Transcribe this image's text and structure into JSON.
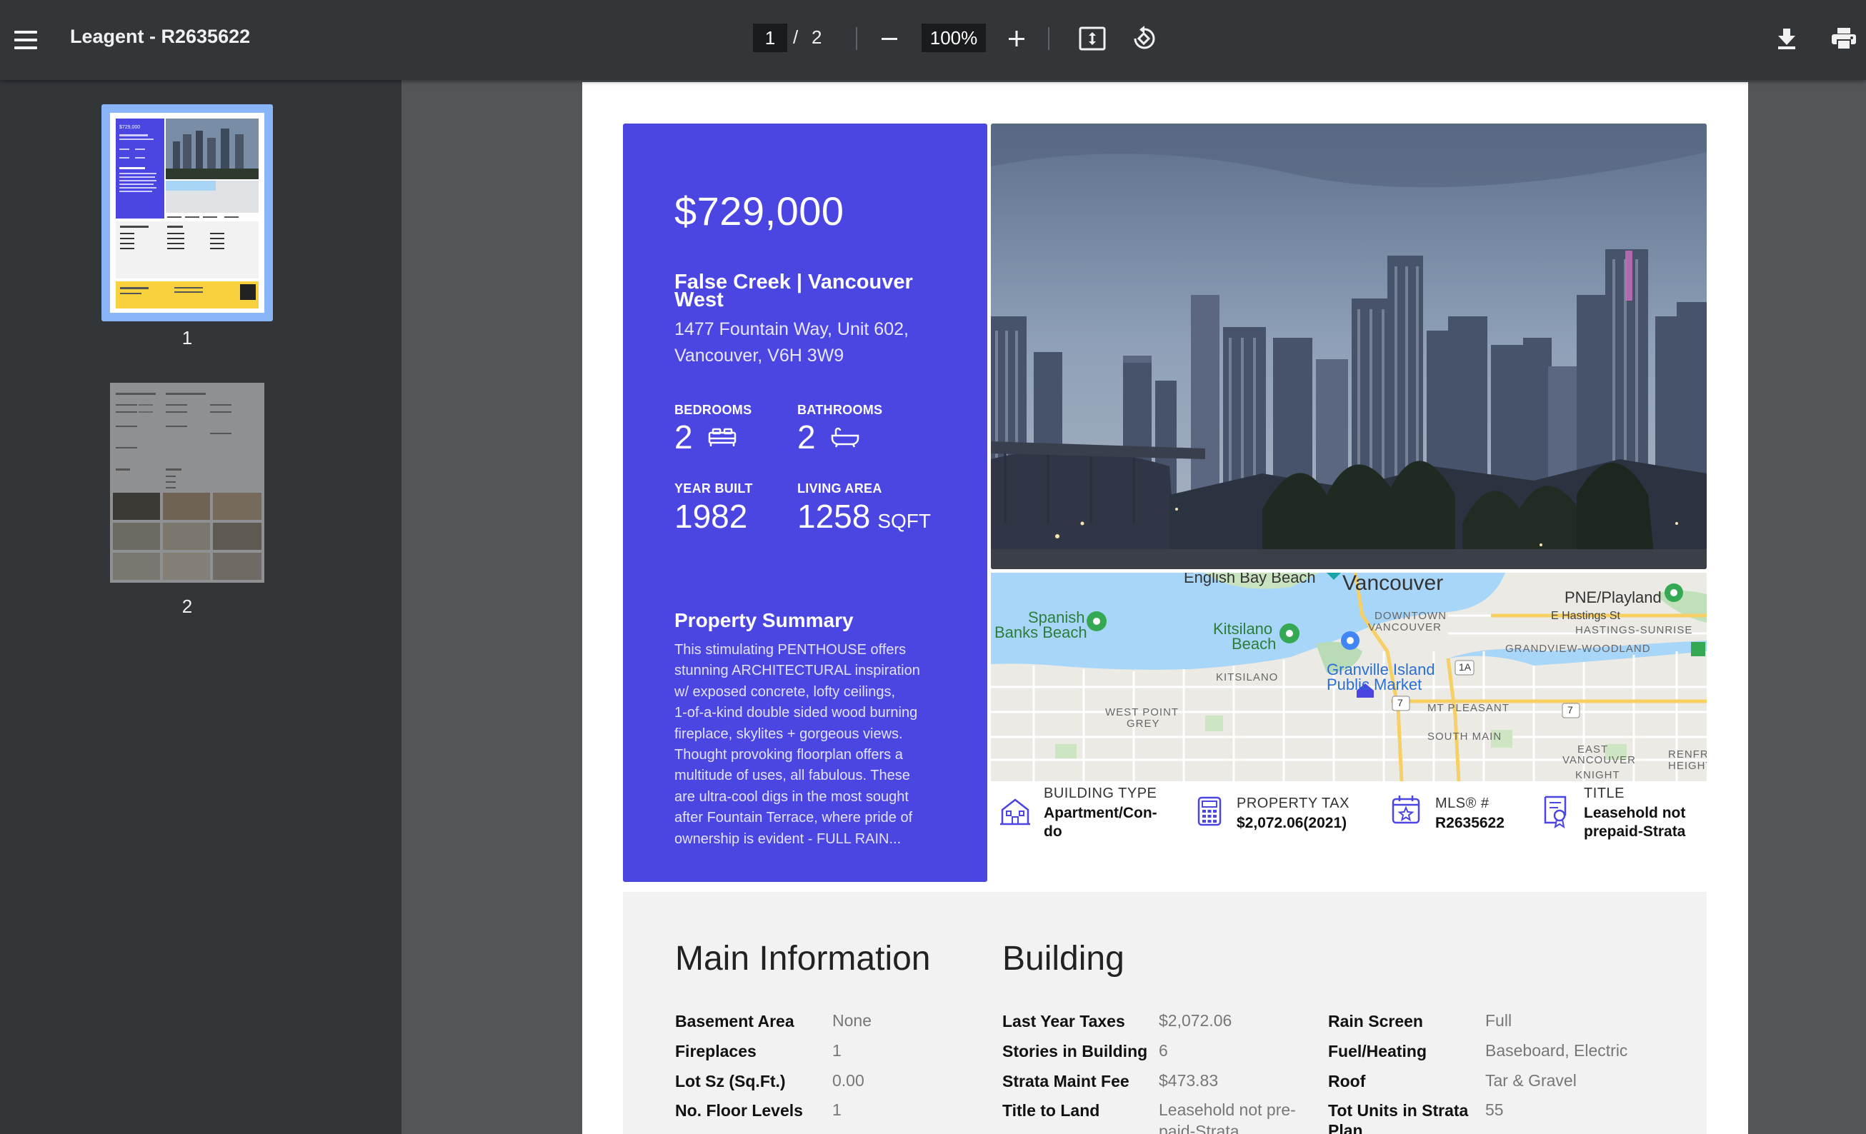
{
  "toolbar": {
    "title": "Leagent - R2635622",
    "current_page": "1",
    "page_separator": "/",
    "total_pages": "2",
    "zoom": "100%"
  },
  "sidebar": {
    "thumbnails": [
      {
        "label": "1",
        "selected": true
      },
      {
        "label": "2",
        "selected": false
      }
    ],
    "thumb1_price": "$729,000"
  },
  "listing": {
    "price": "$729,000",
    "neighbourhood": "False Creek | Vancouver West",
    "address_line1": "1477 Fountain Way, Unit 602,",
    "address_line2": "Vancouver, V6H 3W9",
    "bedrooms_label": "BEDROOMS",
    "bedrooms": "2",
    "bathrooms_label": "BATHROOMS",
    "bathrooms": "2",
    "year_built_label": "YEAR BUILT",
    "year_built": "1982",
    "living_area_label": "LIVING AREA",
    "living_area": "1258",
    "living_area_unit": "SQFT",
    "summary_heading": "Property Summary",
    "summary_lines": [
      "This stimulating PENTHOUSE offers",
      "stunning ARCHITECTURAL inspiration",
      "w/ exposed concrete, lofty ceilings,",
      "1-of-a-kind double sided wood burning",
      "fireplace, skylites + gorgeous views.",
      "Thought provoking floorplan offers a",
      "multitude of uses, all fabulous. These",
      "are ultra-cool digs in the most sought",
      "after Fountain Terrace, where pride of",
      "ownership is evident - FULL RAIN..."
    ]
  },
  "map": {
    "labels": {
      "english_bay": "English Bay Beach",
      "vancouver": "Vancouver",
      "pne": "PNE/Playland",
      "e_hastings": "E Hastings St",
      "downtown1": "DOWNTOWN",
      "downtown2": "VANCOUVER",
      "hastings_sunrise": "HASTINGS-SUNRISE",
      "grandview": "GRANDVIEW-WOODLAND",
      "spanish1": "Spanish",
      "spanish2": "Banks Beach",
      "kits_beach1": "Kitsilano",
      "kits_beach2": "Beach",
      "kitsilano": "KITSILANO",
      "granville1": "Granville Island",
      "granville2": "Public Market",
      "mt_pleasant": "MT PLEASANT",
      "west_point1": "WEST POINT",
      "west_point2": "GREY",
      "south_main": "SOUTH MAIN",
      "east_van1": "EAST",
      "east_van2": "VANCOUVER",
      "knight": "KNIGHT",
      "renfrew1": "RENFREW",
      "renfrew2": "HEIGHTS",
      "route_1a": "1A",
      "route_7a": "7",
      "route_7b": "7"
    }
  },
  "facts": [
    {
      "label": "BUILDING TYPE",
      "value_lines": [
        "Apartment/Con-",
        "do"
      ],
      "icon": "building-icon"
    },
    {
      "label": "PROPERTY TAX",
      "value_lines": [
        "$2,072.06(2021)"
      ],
      "icon": "calculator-icon"
    },
    {
      "label": "MLS® #",
      "value_lines": [
        "R2635622"
      ],
      "icon": "calendar-star-icon"
    },
    {
      "label": "TITLE",
      "value_lines": [
        "Leasehold not",
        "prepaid-Strata"
      ],
      "icon": "certificate-icon"
    }
  ],
  "main_info": {
    "heading": "Main Information",
    "rows": [
      {
        "key": "Basement Area",
        "value": "None"
      },
      {
        "key": "Fireplaces",
        "value": "1"
      },
      {
        "key": "Lot Sz (Sq.Ft.)",
        "value": "0.00"
      },
      {
        "key": "No. Floor Levels",
        "value": "1"
      }
    ]
  },
  "building": {
    "heading": "Building",
    "rows_left": [
      {
        "key": "Last Year Taxes",
        "value": "$2,072.06"
      },
      {
        "key": "Stories in Building",
        "value": "6"
      },
      {
        "key": "Strata Maint Fee",
        "value": "$473.83"
      },
      {
        "key": "Title to Land",
        "value": "Leasehold not pre-",
        "value2": "paid-Strata"
      }
    ],
    "rows_right": [
      {
        "key": "Rain Screen",
        "value": "Full"
      },
      {
        "key": "Fuel/Heating",
        "value": "Baseboard, Electric"
      },
      {
        "key": "Roof",
        "value": "Tar & Gravel"
      },
      {
        "key": "Tot Units in Strata",
        "key2": "Plan",
        "value": "55"
      }
    ]
  },
  "colors": {
    "accent": "#4b45e2",
    "toolbar": "#323639",
    "viewer_bg": "#525659"
  }
}
